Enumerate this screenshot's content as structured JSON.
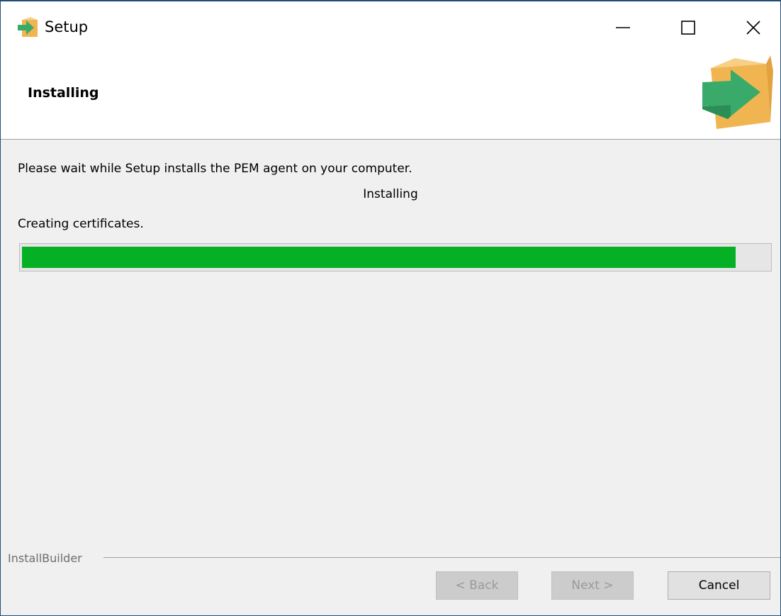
{
  "window": {
    "title": "Setup",
    "icons": [
      "installer-box-icon",
      "minimize-icon",
      "maximize-icon",
      "close-icon"
    ]
  },
  "header": {
    "title": "Installing",
    "logo_icon": "installer-box-arrow-icon"
  },
  "content": {
    "intro": "Please wait while Setup installs the PEM agent on your computer.",
    "status": "Installing",
    "detail": "Creating certificates.",
    "progress": 0.955
  },
  "footer": {
    "brand": "InstallBuilder",
    "back_label": "< Back",
    "next_label": "Next >",
    "cancel_label": "Cancel"
  },
  "colors": {
    "progress_fill": "#06b025",
    "box": "#f0b550",
    "arrow": "#3aaa6b"
  }
}
